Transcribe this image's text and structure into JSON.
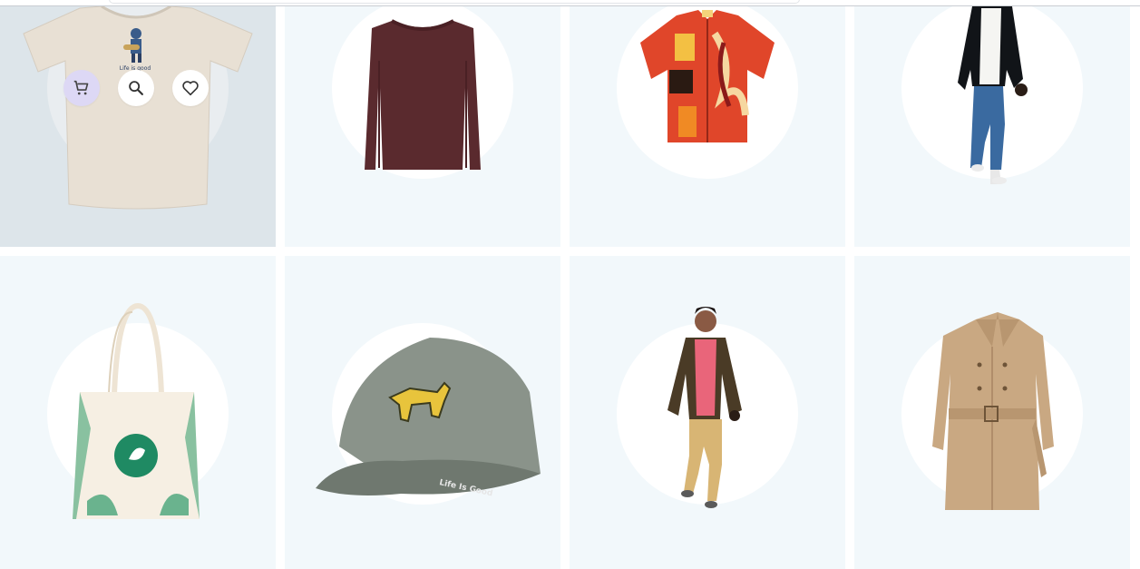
{
  "products": [
    {
      "name": "Life is Good guitarist tee",
      "print": "Life is good"
    },
    {
      "name": "Maroon long sleeve sweater"
    },
    {
      "name": "Patterned camp shirt"
    },
    {
      "name": "Blazer and jeans outfit"
    },
    {
      "name": "Canvas tote bag"
    },
    {
      "name": "Green baseball cap",
      "print": "Life Is Good"
    },
    {
      "name": "Olive blazer outfit"
    },
    {
      "name": "Beige trench coat"
    }
  ],
  "actions": {
    "cart_icon": "shopping-cart-icon",
    "search_icon": "search-icon",
    "wishlist_icon": "heart-icon"
  },
  "colors": {
    "card_bg": "#f2f8fb",
    "card_hover_bg": "#dde5ea",
    "active_action": "#ddd8f5"
  }
}
